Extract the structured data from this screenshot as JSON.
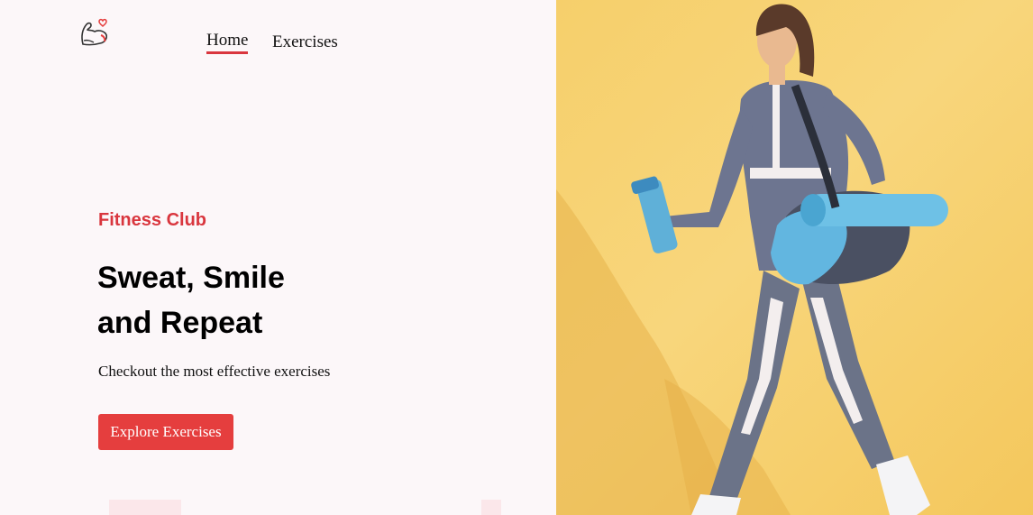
{
  "nav": {
    "logo_icon": "flexed-arm-heart-icon",
    "items": [
      {
        "label": "Home",
        "active": true
      },
      {
        "label": "Exercises",
        "active": false
      }
    ]
  },
  "hero": {
    "eyebrow": "Fitness Club",
    "headline_line1": "Sweat, Smile",
    "headline_line2": "and Repeat",
    "subtitle": "Checkout the most effective exercises",
    "cta_label": "Explore Exercises",
    "image_icon": "woman-walking-with-gym-bag-photo"
  },
  "colors": {
    "accent": "#e53e3e",
    "background": "#fcf7f9",
    "image_bg": "#f6cf6b"
  }
}
